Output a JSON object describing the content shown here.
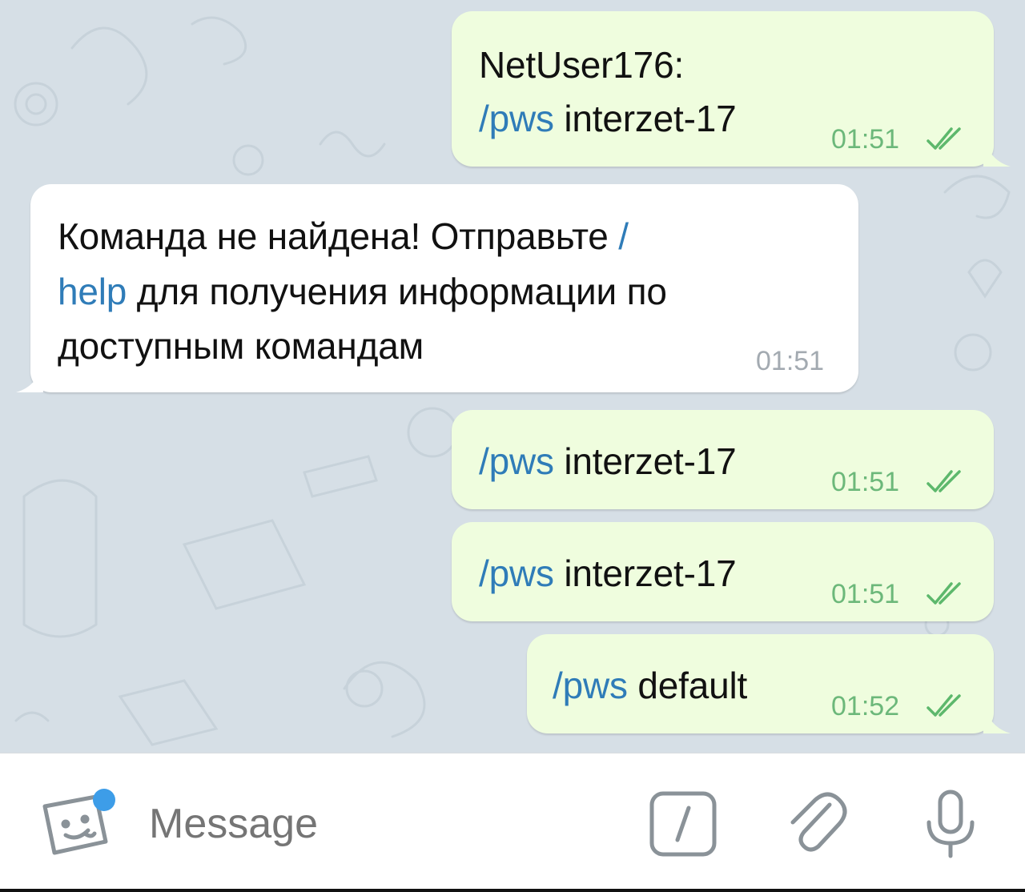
{
  "messages": [
    {
      "direction": "out",
      "sender": "NetUser176:",
      "command": "/pws",
      "args": " interzet-17",
      "time": "01:51",
      "status_icon": "double-check-icon"
    },
    {
      "direction": "in",
      "line1_text": "Команда не найдена! Отправьте ",
      "line1_cmd": "/",
      "line2_cmd": "help",
      "line2_text": " для получения информации по",
      "line3_text": "доступным командам",
      "time": "01:51"
    },
    {
      "direction": "out",
      "command": "/pws",
      "args": " interzet-17",
      "time": "01:51",
      "status_icon": "double-check-icon"
    },
    {
      "direction": "out",
      "command": "/pws",
      "args": " interzet-17",
      "time": "01:51",
      "status_icon": "double-check-icon"
    },
    {
      "direction": "out",
      "command": "/pws",
      "args": " default",
      "time": "01:52",
      "status_icon": "double-check-icon"
    }
  ],
  "composer": {
    "placeholder": "Message",
    "icons": [
      "sticker-icon",
      "bot-command-icon",
      "attach-icon",
      "microphone-icon"
    ]
  },
  "colors": {
    "background": "#d6dfe6",
    "outgoing_bubble": "#effdde",
    "incoming_bubble": "#ffffff",
    "command_link": "#2f7cb8",
    "outgoing_time": "#6cb87a",
    "incoming_time": "#a3aab1",
    "badge": "#3d9de8"
  }
}
